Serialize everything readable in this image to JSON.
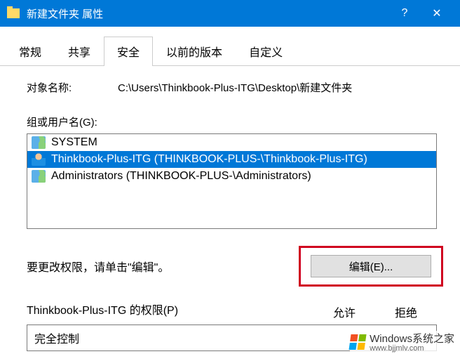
{
  "titlebar": {
    "title": "新建文件夹 属性"
  },
  "tabs": {
    "items": [
      {
        "label": "常规"
      },
      {
        "label": "共享"
      },
      {
        "label": "安全"
      },
      {
        "label": "以前的版本"
      },
      {
        "label": "自定义"
      }
    ],
    "active_index": 2
  },
  "object": {
    "label": "对象名称:",
    "path": "C:\\Users\\Thinkbook-Plus-ITG\\Desktop\\新建文件夹"
  },
  "groups": {
    "label": "组或用户名(G):",
    "items": [
      {
        "icon": "group",
        "name": "SYSTEM",
        "selected": false
      },
      {
        "icon": "user",
        "name": "Thinkbook-Plus-ITG (THINKBOOK-PLUS-\\Thinkbook-Plus-ITG)",
        "selected": true
      },
      {
        "icon": "group",
        "name": "Administrators (THINKBOOK-PLUS-\\Administrators)",
        "selected": false
      }
    ]
  },
  "edit": {
    "hint": "要更改权限，请单击\"编辑\"。",
    "button": "编辑(E)..."
  },
  "permissions": {
    "label": "Thinkbook-Plus-ITG 的权限(P)",
    "col_allow": "允许",
    "col_deny": "拒绝",
    "rows": [
      {
        "name": "完全控制"
      }
    ]
  },
  "watermark": {
    "brand": "Windows",
    "site": "系统之家",
    "url": "www.bjjmlv.com"
  }
}
